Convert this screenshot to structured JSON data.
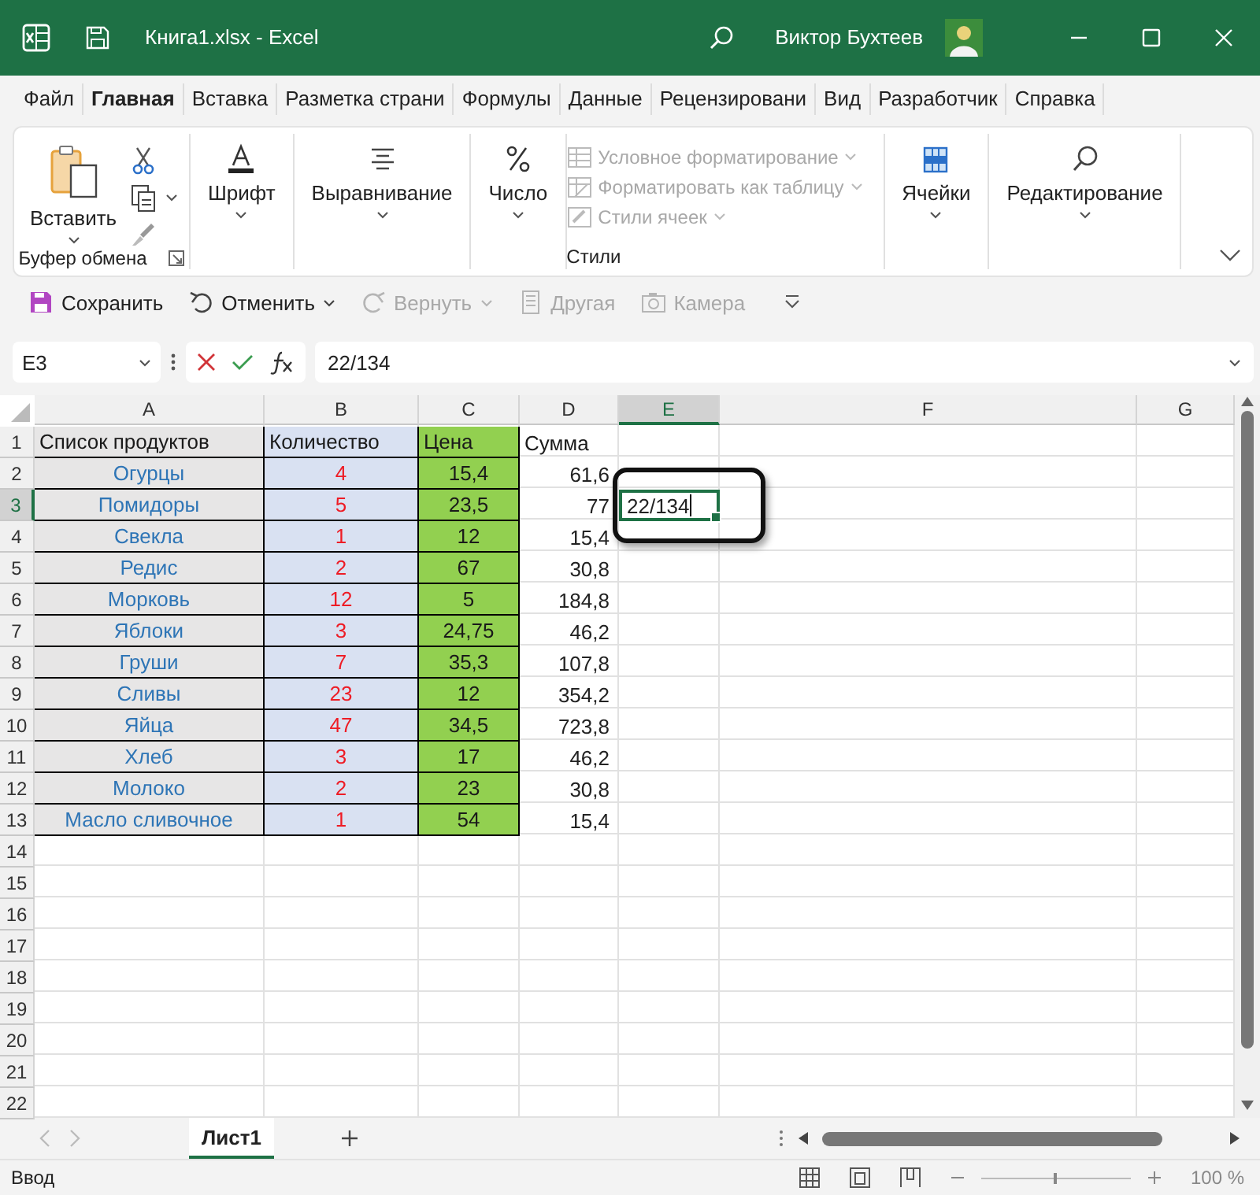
{
  "title_bar": {
    "title": "Книга1.xlsx  -  Excel",
    "user": "Виктор Бухтеев"
  },
  "ribbon_tabs": [
    {
      "label": "Файл",
      "selected": false
    },
    {
      "label": "Главная",
      "selected": true
    },
    {
      "label": "Вставка",
      "selected": false
    },
    {
      "label": "Разметка страни",
      "selected": false
    },
    {
      "label": "Формулы",
      "selected": false
    },
    {
      "label": "Данные",
      "selected": false
    },
    {
      "label": "Рецензировани",
      "selected": false
    },
    {
      "label": "Вид",
      "selected": false
    },
    {
      "label": "Разработчик",
      "selected": false
    },
    {
      "label": "Справка",
      "selected": false
    }
  ],
  "ribbon_groups": [
    {
      "kind": "clipboard",
      "button": "Вставить",
      "label": "Буфер обмена"
    },
    {
      "kind": "font",
      "button": "Шрифт"
    },
    {
      "kind": "alignment",
      "button": "Выравнивание"
    },
    {
      "kind": "number",
      "button": "Число"
    },
    {
      "kind": "styles",
      "label": "Стили",
      "items": [
        {
          "label": "Условное форматирование",
          "disabled": true
        },
        {
          "label": "Форматировать как таблицу",
          "disabled": true
        },
        {
          "label": "Стили ячеек",
          "disabled": true
        }
      ]
    },
    {
      "kind": "cells",
      "button": "Ячейки"
    },
    {
      "kind": "editing",
      "button": "Редактирование"
    }
  ],
  "quick_access": [
    {
      "kind": "save",
      "label": "Сохранить",
      "disabled": false
    },
    {
      "kind": "undo",
      "label": "Отменить",
      "disabled": false
    },
    {
      "kind": "redo",
      "label": "Вернуть",
      "disabled": true
    },
    {
      "kind": "other",
      "label": "Другая",
      "disabled": true
    },
    {
      "kind": "camera",
      "label": "Камера",
      "disabled": true
    }
  ],
  "formula_bar": {
    "name_box": "E3",
    "formula": "22/134"
  },
  "grid": {
    "columns": [
      {
        "label": "A",
        "selected": false
      },
      {
        "label": "B",
        "selected": false
      },
      {
        "label": "C",
        "selected": false
      },
      {
        "label": "D",
        "selected": false
      },
      {
        "label": "E",
        "selected": true
      },
      {
        "label": "F",
        "selected": false
      },
      {
        "label": "G",
        "selected": false
      }
    ],
    "rows": [
      {
        "header": "1",
        "selected": false,
        "kind": "header",
        "cells": [
          "Список продуктов",
          "Количество",
          "Цена",
          "Сумма"
        ]
      },
      {
        "header": "2",
        "selected": false,
        "kind": "data",
        "cells": [
          "Огурцы",
          "4",
          "15,4",
          "61,6"
        ]
      },
      {
        "header": "3",
        "selected": true,
        "kind": "data",
        "cells": [
          "Помидоры",
          "5",
          "23,5",
          "77",
          "22/134"
        ]
      },
      {
        "header": "4",
        "selected": false,
        "kind": "data",
        "cells": [
          "Свекла",
          "1",
          "12",
          "15,4"
        ]
      },
      {
        "header": "5",
        "selected": false,
        "kind": "data",
        "cells": [
          "Редис",
          "2",
          "67",
          "30,8"
        ]
      },
      {
        "header": "6",
        "selected": false,
        "kind": "data",
        "cells": [
          "Морковь",
          "12",
          "5",
          "184,8"
        ]
      },
      {
        "header": "7",
        "selected": false,
        "kind": "data",
        "cells": [
          "Яблоки",
          "3",
          "24,75",
          "46,2"
        ]
      },
      {
        "header": "8",
        "selected": false,
        "kind": "data",
        "cells": [
          "Груши",
          "7",
          "35,3",
          "107,8"
        ]
      },
      {
        "header": "9",
        "selected": false,
        "kind": "data",
        "cells": [
          "Сливы",
          "23",
          "12",
          "354,2"
        ]
      },
      {
        "header": "10",
        "selected": false,
        "kind": "data",
        "cells": [
          "Яйца",
          "47",
          "34,5",
          "723,8"
        ]
      },
      {
        "header": "11",
        "selected": false,
        "kind": "data",
        "cells": [
          "Хлеб",
          "3",
          "17",
          "46,2"
        ]
      },
      {
        "header": "12",
        "selected": false,
        "kind": "data",
        "cells": [
          "Молоко",
          "2",
          "23",
          "30,8"
        ]
      },
      {
        "header": "13",
        "selected": false,
        "kind": "data",
        "cells": [
          "Масло сливочное",
          "1",
          "54",
          "15,4"
        ]
      },
      {
        "header": "14",
        "selected": false,
        "kind": "empty"
      },
      {
        "header": "15",
        "selected": false,
        "kind": "empty"
      },
      {
        "header": "16",
        "selected": false,
        "kind": "empty"
      },
      {
        "header": "17",
        "selected": false,
        "kind": "empty"
      },
      {
        "header": "18",
        "selected": false,
        "kind": "empty"
      },
      {
        "header": "19",
        "selected": false,
        "kind": "empty"
      },
      {
        "header": "20",
        "selected": false,
        "kind": "empty"
      },
      {
        "header": "21",
        "selected": false,
        "kind": "empty"
      },
      {
        "header": "22",
        "selected": false,
        "kind": "empty"
      }
    ]
  },
  "sheet_tabs": [
    {
      "label": "Лист1",
      "selected": true
    }
  ],
  "status_bar": {
    "mode": "Ввод",
    "zoom": {
      "level": 0.5,
      "reading": "100 %"
    }
  }
}
